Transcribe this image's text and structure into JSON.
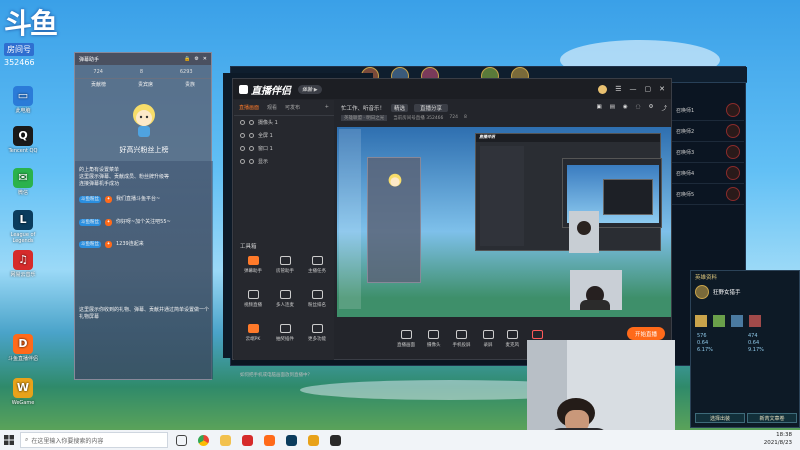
{
  "desktop": {
    "logo_big": "斗鱼",
    "logo_sub": "房间号",
    "room_id": "352466",
    "icons": [
      {
        "label": "此电脑",
        "glyph": "▭",
        "color": "#2b7bd8"
      },
      {
        "label": "Tencent QQ",
        "glyph": "Q",
        "color": "#1a1a1a"
      },
      {
        "label": "微信",
        "glyph": "✉",
        "color": "#2bb24c"
      },
      {
        "label": "League of Legends",
        "glyph": "L",
        "color": "#0b3c5d"
      },
      {
        "label": "网易云音乐",
        "glyph": "♫",
        "color": "#d62b2b"
      },
      {
        "label": "斗鱼直播伴侣",
        "glyph": "D",
        "color": "#ff6a1a"
      },
      {
        "label": "WeGame",
        "glyph": "W",
        "color": "#e8a21a"
      }
    ]
  },
  "taskbar": {
    "search_placeholder": "在这里输入你要搜索的内容",
    "time": "18:38",
    "date": "2021/8/23"
  },
  "chat_panel": {
    "title": "弹幕助手",
    "stats": [
      "724",
      "8",
      "6293"
    ],
    "tabs": [
      "贡献榜",
      "贵宾席",
      "贵族"
    ],
    "slogan": "好高兴粉丝上榜",
    "intro": "的上角有设置菜单\n这里展示弹幕、贡献成员、粉丝牌升级等\n连接弹幕机手成功",
    "messages": [
      {
        "badge": "斗鱼粉丝",
        "text": "我们直播斗鱼平台~"
      },
      {
        "badge": "斗鱼粉丝",
        "text": "你好呀~加个关注吧55~"
      },
      {
        "badge": "斗鱼粉丝",
        "text": "1239连起来"
      }
    ],
    "footer": "这里展示你收到的礼物、弹幕、贡献并通过简单设置做一个礼物屏幕"
  },
  "main_window": {
    "brand": "直播伴侣",
    "beta": "体验 ▶",
    "sidebar_tabs": [
      "直播画面",
      "观看",
      "可发布"
    ],
    "scenes": [
      "摄像头 1",
      "全屏 1",
      "窗口 1",
      "显示"
    ],
    "toolbox_title": "工具箱",
    "tools": [
      "弹幕助手",
      "房管助手",
      "主播任务",
      "视频直播",
      "多人连麦",
      "粉丝排名",
      "云端PK",
      "抽奖插件",
      "更多功能"
    ],
    "info_title": "忙工作、听音乐！",
    "info_tag": "精选",
    "info_btn": "直播分享",
    "info_sub": "英雄联盟 · 明日之光",
    "info_meta": "当前房间号直播 352466",
    "info_count": "724",
    "info_hot": "8",
    "bottom_tools": [
      "直播画面",
      "摄像头",
      "手机投屏",
      "录屏",
      "麦克风",
      "扬声器"
    ],
    "go_live": "开始直播",
    "tip": "如何把手机或电脑画面放到直播中？"
  },
  "game": {
    "slots": [
      "召唤师1",
      "召唤师2",
      "召唤师3",
      "召唤师4",
      "召唤师5"
    ],
    "panel_title": "英雄资料",
    "hero_name": "狂野女猎手",
    "stats": [
      "576",
      "474",
      "0.64",
      "0.64",
      "6.17%",
      "9.17%"
    ],
    "btn_left": "选择出装",
    "btn_right": "新芮文章卷"
  }
}
